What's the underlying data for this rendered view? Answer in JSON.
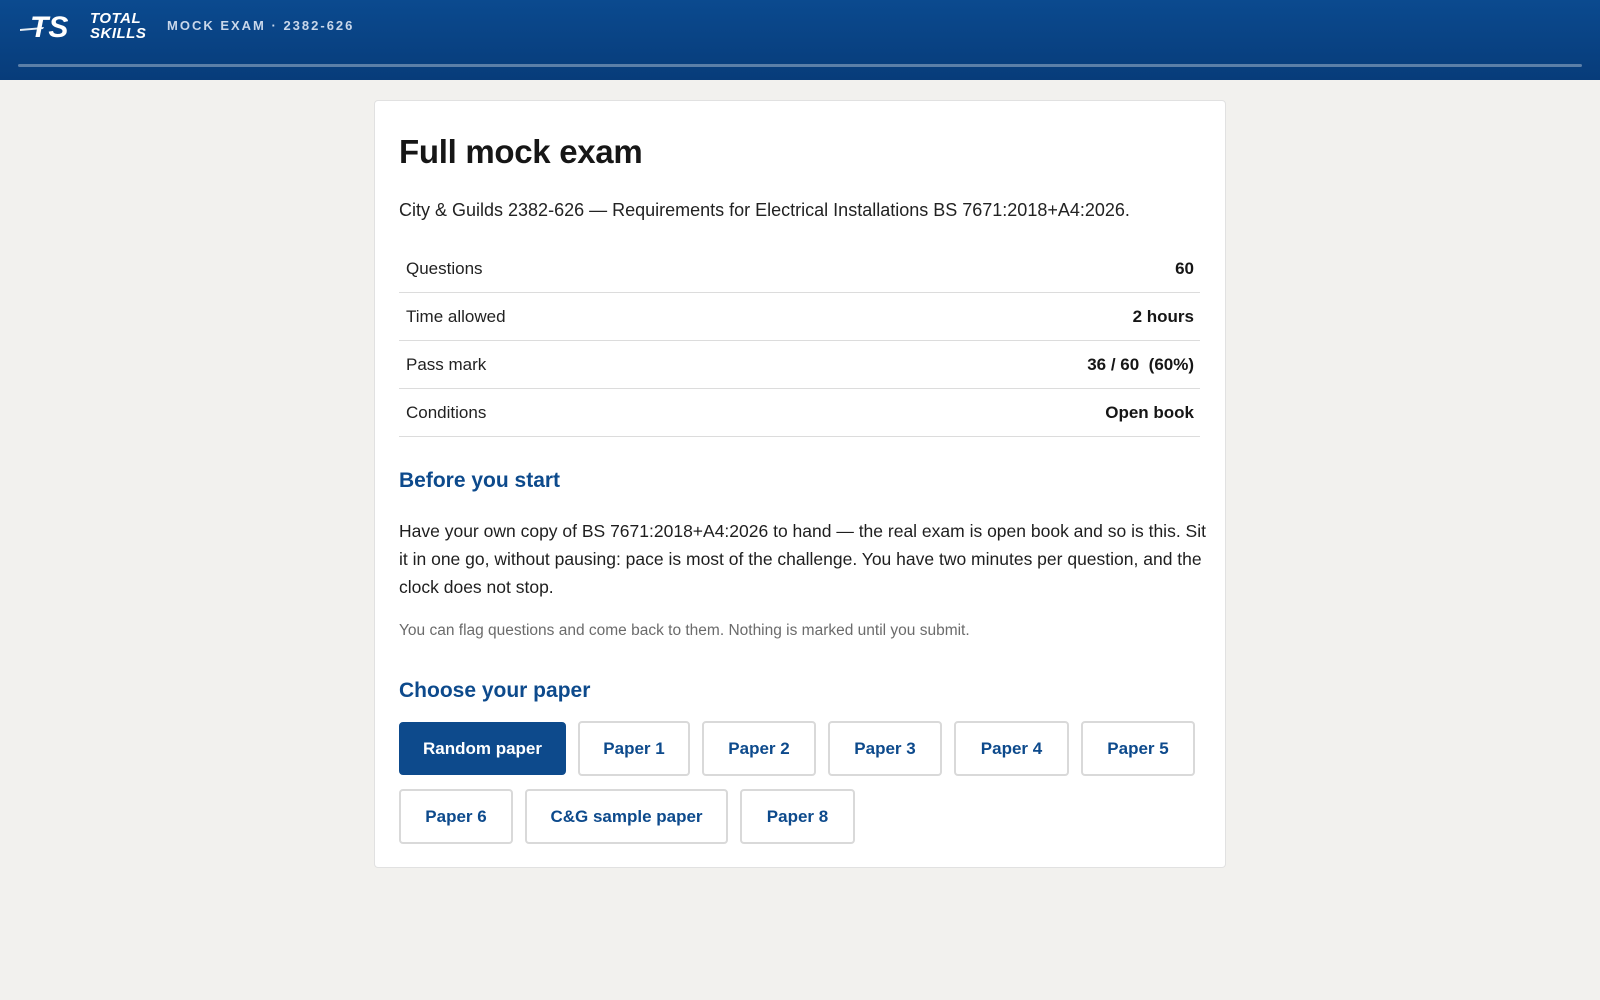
{
  "header": {
    "logo_line1": "TOTAL",
    "logo_line2": "SKILLS",
    "logo_mark": "TS",
    "breadcrumb": "MOCK EXAM · 2382-626",
    "brand_color": "#0b4a8f"
  },
  "main": {
    "title": "Full mock exam",
    "subtitle": "City & Guilds 2382-626 — Requirements for Electrical Installations BS 7671:2018+A4:2026.",
    "facts": [
      {
        "label": "Questions",
        "value": "60"
      },
      {
        "label": "Time allowed",
        "value": "2 hours"
      },
      {
        "label": "Pass mark",
        "value": "36 / 60  (60%)"
      },
      {
        "label": "Conditions",
        "value": "Open book"
      }
    ],
    "before_heading": "Before you start",
    "before_text": "Have your own copy of BS 7671:2018+A4:2026 to hand — the real exam is open book and so is this. Sit it in one go, without pausing: pace is most of the challenge. You have two minutes per question, and the clock does not stop.",
    "note": "You can flag questions and come back to them. Nothing is marked until you submit.",
    "choose_heading": "Choose your paper",
    "papers": [
      {
        "label": "Random paper",
        "selected": true
      },
      {
        "label": "Paper 1",
        "selected": false
      },
      {
        "label": "Paper 2",
        "selected": false
      },
      {
        "label": "Paper 3",
        "selected": false
      },
      {
        "label": "Paper 4",
        "selected": false
      },
      {
        "label": "Paper 5",
        "selected": false
      },
      {
        "label": "Paper 6",
        "selected": false
      },
      {
        "label": "C&G sample paper",
        "selected": false
      },
      {
        "label": "Paper 8",
        "selected": false
      }
    ]
  }
}
